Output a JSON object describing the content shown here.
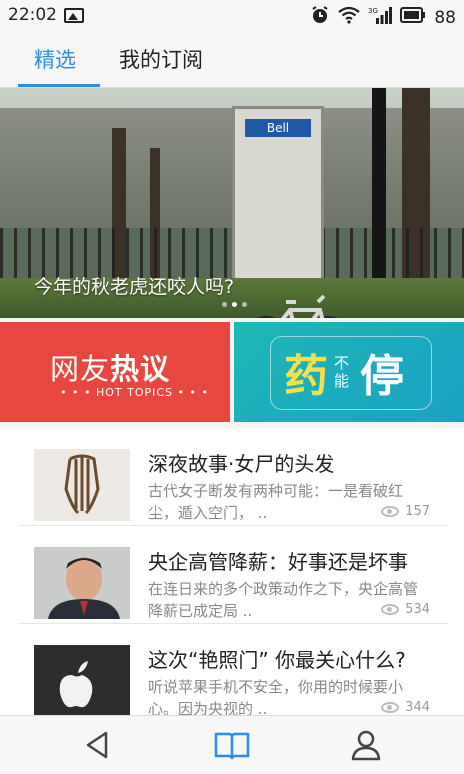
{
  "status_bar": {
    "time": "22:02",
    "battery": "88",
    "network": "3G"
  },
  "tabs": [
    {
      "label": "精选",
      "active": true
    },
    {
      "label": "我的订阅",
      "active": false
    }
  ],
  "banner": {
    "caption": "今年的秋老虎还咬人吗?",
    "sign_text": "Bell",
    "slide_count": 3,
    "active_slide": 2
  },
  "promos": {
    "hot": {
      "title_light": "网友",
      "title_bold": "热议",
      "subtitle": "• • • HOT TOPICS • • •"
    },
    "drug": {
      "char1": "药",
      "small": "不能",
      "char2": "停"
    }
  },
  "articles": [
    {
      "title": "深夜故事·女尸的头发",
      "summary": "古代女子断发有两种可能：一是看破红尘，遁入空门，  ..",
      "views": "157"
    },
    {
      "title": "央企高管降薪：好事还是坏事",
      "summary": "在连日来的多个政策动作之下，央企高管降薪已成定局  ..",
      "views": "534"
    },
    {
      "title": "这次“艳照门” 你最关心什么?",
      "summary": "听说苹果手机不安全，你用的时候要小心。因为央视的  ..",
      "views": "344"
    }
  ],
  "colors": {
    "accent": "#2b8ee0",
    "hot_bg": "#e8473f",
    "drug_bg": "#1fb7b6",
    "drug_yellow": "#f5e04a"
  },
  "icons": {
    "back": "back-triangle-icon",
    "reader": "open-book-icon",
    "profile": "person-icon"
  }
}
